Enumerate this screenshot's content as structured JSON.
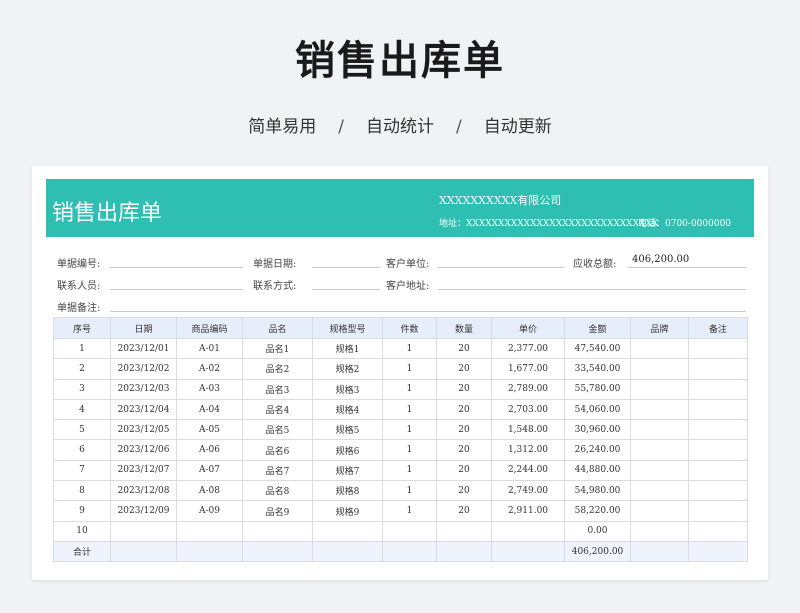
{
  "header": {
    "title": "销售出库单",
    "subtitle": [
      "简单易用",
      "自动统计",
      "自动更新"
    ],
    "separator": "/"
  },
  "sheet": {
    "banner_title": "销售出库单",
    "company": "XXXXXXXXXX有限公司",
    "address": "地址：XXXXXXXXXXXXXXXXXXXXXXXXXXXXXX",
    "phone": "电话：0700-0000000",
    "brand_color": "#2fbfb2",
    "fields": {
      "doc_no_label": "单据编号:",
      "doc_date_label": "单据日期:",
      "customer_label": "客户单位:",
      "receivable_label": "应收总额:",
      "receivable_value": "406,200.00",
      "contact_label": "联系人员:",
      "contact_method_label": "联系方式:",
      "customer_addr_label": "客户地址:",
      "remark_label": "单据备注:"
    },
    "columns": [
      "序号",
      "日期",
      "商品编码",
      "品名",
      "规格型号",
      "件数",
      "数量",
      "单价",
      "金额",
      "品牌",
      "备注"
    ],
    "rows": [
      [
        "1",
        "2023/12/01",
        "A-01",
        "品名1",
        "规格1",
        "1",
        "20",
        "2,377.00",
        "47,540.00",
        "",
        ""
      ],
      [
        "2",
        "2023/12/02",
        "A-02",
        "品名2",
        "规格2",
        "1",
        "20",
        "1,677.00",
        "33,540.00",
        "",
        ""
      ],
      [
        "3",
        "2023/12/03",
        "A-03",
        "品名3",
        "规格3",
        "1",
        "20",
        "2,789.00",
        "55,780.00",
        "",
        ""
      ],
      [
        "4",
        "2023/12/04",
        "A-04",
        "品名4",
        "规格4",
        "1",
        "20",
        "2,703.00",
        "54,060.00",
        "",
        ""
      ],
      [
        "5",
        "2023/12/05",
        "A-05",
        "品名5",
        "规格5",
        "1",
        "20",
        "1,548.00",
        "30,960.00",
        "",
        ""
      ],
      [
        "6",
        "2023/12/06",
        "A-06",
        "品名6",
        "规格6",
        "1",
        "20",
        "1,312.00",
        "26,240.00",
        "",
        ""
      ],
      [
        "7",
        "2023/12/07",
        "A-07",
        "品名7",
        "规格7",
        "1",
        "20",
        "2,244.00",
        "44,880.00",
        "",
        ""
      ],
      [
        "8",
        "2023/12/08",
        "A-08",
        "品名8",
        "规格8",
        "1",
        "20",
        "2,749.00",
        "54,980.00",
        "",
        ""
      ],
      [
        "9",
        "2023/12/09",
        "A-09",
        "品名9",
        "规格9",
        "1",
        "20",
        "2,911.00",
        "58,220.00",
        "",
        ""
      ],
      [
        "10",
        "",
        "",
        "",
        "",
        "",
        "",
        "",
        "0.00",
        "",
        ""
      ]
    ],
    "total_row": [
      "合计",
      "",
      "",
      "",
      "",
      "",
      "",
      "",
      "406,200.00",
      "",
      ""
    ]
  }
}
